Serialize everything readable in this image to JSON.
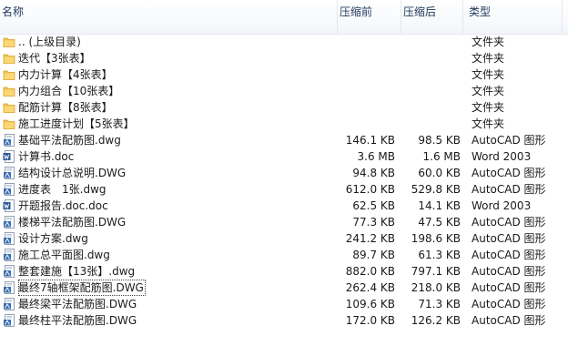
{
  "columns": {
    "name": "名称",
    "before": "压缩前",
    "after": "压缩后",
    "type": "类型"
  },
  "rows": [
    {
      "icon": "folder-icon",
      "name": ".. (上级目录)",
      "before": "",
      "after": "",
      "type": "文件夹"
    },
    {
      "icon": "folder-icon",
      "name": "迭代【3张表】",
      "before": "",
      "after": "",
      "type": "文件夹"
    },
    {
      "icon": "folder-icon",
      "name": "内力计算【4张表】",
      "before": "",
      "after": "",
      "type": "文件夹"
    },
    {
      "icon": "folder-icon",
      "name": "内力组合【10张表】",
      "before": "",
      "after": "",
      "type": "文件夹"
    },
    {
      "icon": "folder-icon",
      "name": "配筋计算【8张表】",
      "before": "",
      "after": "",
      "type": "文件夹"
    },
    {
      "icon": "folder-icon",
      "name": "施工进度计划【5张表】",
      "before": "",
      "after": "",
      "type": "文件夹"
    },
    {
      "icon": "autocad-file-icon",
      "name": "基础平法配筋图.dwg",
      "before": "146.1 KB",
      "after": "98.5 KB",
      "type": "AutoCAD 图形"
    },
    {
      "icon": "word-file-icon",
      "name": "计算书.doc",
      "before": "3.6 MB",
      "after": "1.6 MB",
      "type": "Word 2003"
    },
    {
      "icon": "autocad-file-icon",
      "name": "结构设计总说明.DWG",
      "before": "94.8 KB",
      "after": "60.0 KB",
      "type": "AutoCAD 图形"
    },
    {
      "icon": "autocad-file-icon",
      "name": "进度表　1张.dwg",
      "before": "612.0 KB",
      "after": "529.8 KB",
      "type": "AutoCAD 图形"
    },
    {
      "icon": "word-file-icon",
      "name": "开题报告.doc.doc",
      "before": "62.5 KB",
      "after": "14.1 KB",
      "type": "Word 2003"
    },
    {
      "icon": "autocad-file-icon",
      "name": "楼梯平法配筋图.DWG",
      "before": "77.3 KB",
      "after": "47.5 KB",
      "type": "AutoCAD 图形"
    },
    {
      "icon": "autocad-file-icon",
      "name": "设计方案.dwg",
      "before": "241.2 KB",
      "after": "198.6 KB",
      "type": "AutoCAD 图形"
    },
    {
      "icon": "autocad-file-icon",
      "name": "施工总平面图.dwg",
      "before": "89.7 KB",
      "after": "61.3 KB",
      "type": "AutoCAD 图形"
    },
    {
      "icon": "autocad-file-icon",
      "name": "整套建施【13张】.dwg",
      "before": "882.0 KB",
      "after": "797.1 KB",
      "type": "AutoCAD 图形"
    },
    {
      "icon": "autocad-file-icon",
      "name": "最终7轴框架配筋图.DWG",
      "before": "262.4 KB",
      "after": "218.0 KB",
      "type": "AutoCAD 图形",
      "focused": true
    },
    {
      "icon": "autocad-file-icon",
      "name": "最终梁平法配筋图.DWG",
      "before": "109.6 KB",
      "after": "71.3 KB",
      "type": "AutoCAD 图形"
    },
    {
      "icon": "autocad-file-icon",
      "name": "最终柱平法配筋图.DWG",
      "before": "172.0 KB",
      "after": "126.2 KB",
      "type": "AutoCAD 图形"
    }
  ],
  "colors": {
    "folder": "#f2c24f",
    "folder_dark": "#d9a22a",
    "autocad": "#3a6fb0",
    "word": "#2b5797",
    "header_text": "#1e395b"
  }
}
